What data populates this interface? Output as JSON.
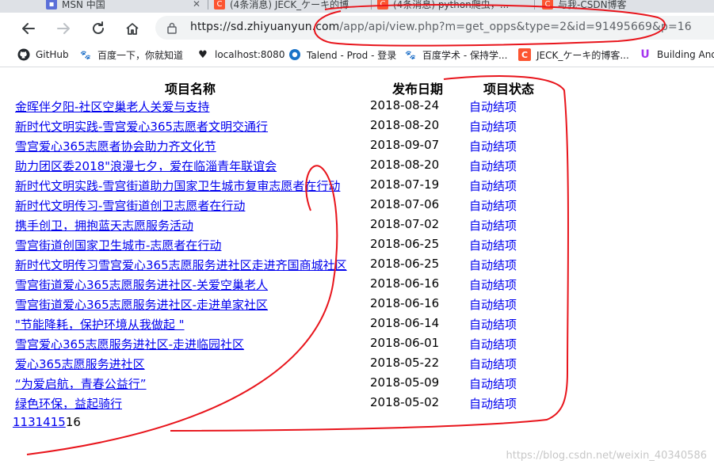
{
  "tabs": [
    {
      "title": "MSN 中国",
      "favicon": "msn-icon",
      "color": "#5b6fd8"
    },
    {
      "title": "(4条消息) JECK_ケーキ的博",
      "favicon": "csdn-icon",
      "color": "#fc5531"
    },
    {
      "title": "(4条消息) python爬虫，...",
      "favicon": "csdn-icon",
      "color": "#fc5531"
    },
    {
      "title": "与我-CSDN博客",
      "favicon": "csdn-icon",
      "color": "#fc5531"
    }
  ],
  "address_bar": {
    "host": "https://sd.zhiyuanyun.com",
    "path": "/app/api/view.php?m=get_opps&type=2&id=91495669&p=16"
  },
  "bookmarks": [
    {
      "label": "GitHub",
      "icon": "github-icon"
    },
    {
      "label": "百度一下，你就知道",
      "icon": "baidu-paw-icon"
    },
    {
      "label": "localhost:8080",
      "icon": "heart-icon"
    },
    {
      "label": "Talend - Prod - 登录",
      "icon": "talend-icon"
    },
    {
      "label": "百度学术 - 保持学...",
      "icon": "baidu-paw-icon"
    },
    {
      "label": "JECK_ケーキ的博客...",
      "icon": "csdn-icon"
    },
    {
      "label": "Building Andr",
      "icon": "udemy-icon"
    }
  ],
  "table": {
    "headers": [
      "项目名称",
      "发布日期",
      "项目状态"
    ],
    "rows": [
      {
        "name": "金晖伴夕阳-社区空巢老人关爱与支持",
        "date": "2018-08-24",
        "status": "自动结项"
      },
      {
        "name": "新时代文明实践-雪宫爱心365志愿者文明交通行",
        "date": "2018-08-20",
        "status": "自动结项"
      },
      {
        "name": "雪宫爱心365志愿者协会助力齐文化节",
        "date": "2018-09-07",
        "status": "自动结项"
      },
      {
        "name": "助力团区委2018\"浪漫七夕，爱在临淄青年联谊会",
        "date": "2018-08-20",
        "status": "自动结项"
      },
      {
        "name": "新时代文明实践-雪宫街道助力国家卫生城市复审志愿者在行动",
        "date": "2018-07-19",
        "status": "自动结项"
      },
      {
        "name": "新时代文明传习-雪宫街道创卫志愿者在行动",
        "date": "2018-07-06",
        "status": "自动结项"
      },
      {
        "name": "携手创卫，拥抱蓝天志愿服务活动",
        "date": "2018-07-02",
        "status": "自动结项"
      },
      {
        "name": "雪宫街道创国家卫生城市-志愿者在行动",
        "date": "2018-06-25",
        "status": "自动结项"
      },
      {
        "name": "新时代文明传习雪宫爱心365志愿服务进社区走进齐国商城社区",
        "date": "2018-06-25",
        "status": "自动结项"
      },
      {
        "name": "雪宫街道爱心365志愿服务进社区-关爱空巢老人",
        "date": "2018-06-16",
        "status": "自动结项"
      },
      {
        "name": "雪宫街道爱心365志愿服务进社区-走进单家社区",
        "date": "2018-06-16",
        "status": "自动结项"
      },
      {
        "name": "\"节能降耗，保护环境从我做起 \"",
        "date": "2018-06-14",
        "status": "自动结项"
      },
      {
        "name": "雪宫爱心365志愿服务进社区-走进临园社区",
        "date": "2018-06-01",
        "status": "自动结项"
      },
      {
        "name": "爱心365志愿服务进社区",
        "date": "2018-05-22",
        "status": "自动结项"
      },
      {
        "name": " “为爱启航，青春公益行” ",
        "date": "2018-05-09",
        "status": "自动结项"
      },
      {
        "name": "绿色环保，益起骑行",
        "date": "2018-05-02",
        "status": "自动结项"
      }
    ]
  },
  "pagination": {
    "links": [
      "11",
      "3",
      "14",
      "15"
    ],
    "current": "16"
  },
  "watermark": "https://blog.csdn.net/weixin_40340586",
  "annotation_color": "#e8141b"
}
